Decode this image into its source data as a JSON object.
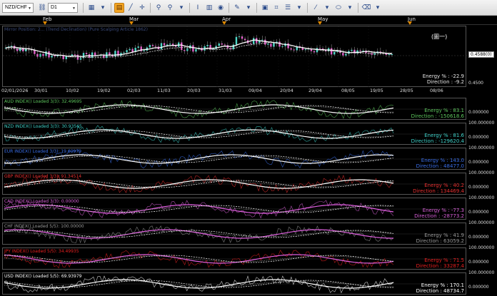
{
  "toolbar": {
    "symbol": "NZD/CHF",
    "timeframe": "D1",
    "icons": [
      "chart-type-icon",
      "period-icon",
      "line-icon",
      "crosshair-icon",
      "zoom-in-icon",
      "zoom-out-icon",
      "text-icon",
      "grid-icon",
      "globe-icon",
      "pencil-icon",
      "image-icon",
      "list-icon",
      "brush-icon",
      "ellipse-icon",
      "eraser-icon"
    ]
  },
  "months": [
    "Feb",
    "Mar",
    "Apr",
    "May",
    "Jun"
  ],
  "dates": [
    "02/01/2026",
    "30/01",
    "10/02",
    "19/02",
    "02/03",
    "11/03",
    "20/03",
    "31/03",
    "09/04",
    "20/04",
    "29/04",
    "08/05",
    "19/05",
    "28/05",
    "08/06"
  ],
  "main": {
    "faint_label": "Mirror Position: 2... (Trend Declination)  (Pure Scalping  Article 1862)",
    "chinese": "(圖一)",
    "price_label": "0.4588(0)",
    "level_top": "",
    "level_bottom": "0.4500",
    "energy": "Energy % : -22.9",
    "direction": "Direction : -9.2"
  },
  "indexes": [
    {
      "label": "AUD INDEX() Loaded 3/3): 32.49695",
      "energy": "Energy % : 83.1",
      "direction": "Direction : -150618.6",
      "axis": "0.000000",
      "color": "#5ec85e",
      "top_axis": ""
    },
    {
      "label": "NZD INDEX() Loaded 3/3): 30.93565",
      "energy": "Energy % : 81.6",
      "direction": "Direction : -129620.4",
      "axis": "0.000000",
      "color": "#3fd0c8",
      "top_axis": "100.000000"
    },
    {
      "label": "EUR INDEX() Loaded 3/3): 19.60979",
      "energy": "Energy % : 143.0",
      "direction": "Direction : 48477.0",
      "axis": "0.000000",
      "color": "#3a6ee8",
      "top_axis": "100.000000"
    },
    {
      "label": "GBP INDEX() Loaded 3/3): 91.34514",
      "energy": "Energy % : 40.2",
      "direction": "Direction : 134469.4",
      "axis": "0.000000",
      "color": "#e83030",
      "top_axis": "100.000000"
    },
    {
      "label": "CAD INDEX() Loaded 3/3): 0.00000",
      "energy": "Energy % : -77.3",
      "direction": "Direction : -28773.2",
      "axis": "0.000000",
      "color": "#d860d8",
      "top_axis": "100.000000"
    },
    {
      "label": "CHF INDEX() Loaded 5/5): 100.00000",
      "energy": "Energy % : 41.9",
      "direction": "Direction : 63059.2",
      "axis": "0.000000",
      "color": "#9a9a9a",
      "top_axis": "100.000000"
    },
    {
      "label": "JPY INDEX() Loaded 5/5): 34.49935",
      "energy": "Energy % : 71.5",
      "direction": "Direction : 33287.4",
      "axis": "0.000000",
      "color": "#e82020",
      "top_axis": "100.000000"
    },
    {
      "label": "USD INDEX() Loaded 5/5): 69.93979",
      "energy": "Energy % : 170.1",
      "direction": "Direction : 48734.7",
      "axis": "0.000000",
      "color": "#ffffff",
      "top_axis": "100.000000"
    }
  ]
}
